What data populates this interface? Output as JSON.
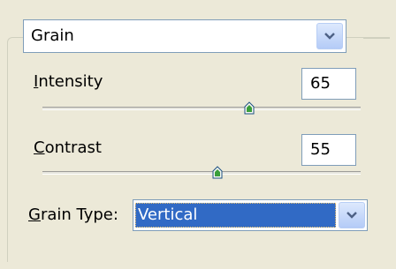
{
  "filter": {
    "selected": "Grain"
  },
  "controls": {
    "intensity": {
      "label": "Intensity",
      "mnemonic": "I",
      "value": "65",
      "slider_fraction": 0.65
    },
    "contrast": {
      "label": "Contrast",
      "mnemonic": "C",
      "value": "55",
      "slider_fraction": 0.55
    }
  },
  "grain_type": {
    "label": "Grain Type:",
    "mnemonic": "G",
    "selected": "Vertical"
  },
  "icons": {
    "dropdown": "chevron-down-icon",
    "slider_thumb": "slider-thumb-icon"
  },
  "colors": {
    "background": "#ece9d8",
    "selection": "#316ac5",
    "accent_green": "#3a9f3a"
  }
}
